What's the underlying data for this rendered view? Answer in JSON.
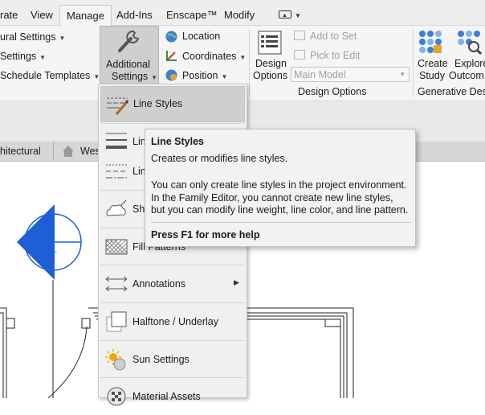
{
  "tabs": [
    "rate",
    "View",
    "Manage",
    "Add-Ins",
    "Enscape™",
    "Modify"
  ],
  "ribbon": {
    "settings_items": [
      "ural Settings",
      "Settings",
      "Schedule  Templates"
    ],
    "additional_settings": {
      "line1": "Additional",
      "line2": "Settings"
    },
    "location": "Location",
    "coordinates": "Coordinates",
    "position": "Position",
    "design_options": {
      "line1": "Design",
      "line2": "Options"
    },
    "add_to_set": "Add to Set",
    "pick_to_edit": "Pick to Edit",
    "main_model": "Main Model",
    "design_options_panel": "Design Options",
    "create_study": {
      "line1": "Create",
      "line2": "Study"
    },
    "explore_outcomes": {
      "line1": "Explore",
      "line2": "Outcom"
    },
    "generative_design_panel": "Generative Desig"
  },
  "view_tabs": {
    "architectural": "hitectural",
    "west": "Wes"
  },
  "section_marker": {
    "top": "-",
    "bottom": "---"
  },
  "dropdown": {
    "items": [
      {
        "label": "Line Styles",
        "icon": "line-styles-icon"
      },
      {
        "label": "Lin",
        "icon": "line-weights-icon"
      },
      {
        "label": "Lin",
        "icon": "line-patterns-icon"
      },
      {
        "label": "She",
        "icon": "sheet-issues-icon"
      },
      {
        "label": "Fill Patterns",
        "icon": "fill-patterns-icon"
      },
      {
        "label": "Annotations",
        "icon": "annotations-icon"
      },
      {
        "label": "Halftone / Underlay",
        "icon": "halftone-icon"
      },
      {
        "label": "Sun Settings",
        "icon": "sun-settings-icon"
      },
      {
        "label": "Material Assets",
        "icon": "material-assets-icon"
      }
    ]
  },
  "tooltip": {
    "title": "Line Styles",
    "subtitle": "Creates or modifies line styles.",
    "body": "You can only create line styles in the project environment. In the Family Editor, you cannot create new line styles, but you can modify line weight, line color, and line pattern.",
    "help": "Press F1 for more help"
  },
  "colors": {
    "accent_blue": "#1f5fd6",
    "highlight": "#cfcfcf"
  }
}
